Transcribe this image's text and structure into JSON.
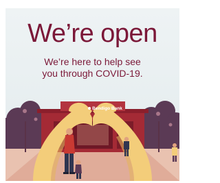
{
  "banner": {
    "headline": "We’re open",
    "subline_1": "We’re here to help see",
    "subline_2": "you through COVID-19.",
    "branch_sign": "Bendigo Bank"
  },
  "colors": {
    "brand_maroon": "#7b1838",
    "background": "#eef3f4",
    "hands": "#f3cd7a",
    "building_red": "#a42a35",
    "trees": "#5b3a55"
  },
  "icons": {
    "brand_logo": "bendigo-logo-icon"
  }
}
